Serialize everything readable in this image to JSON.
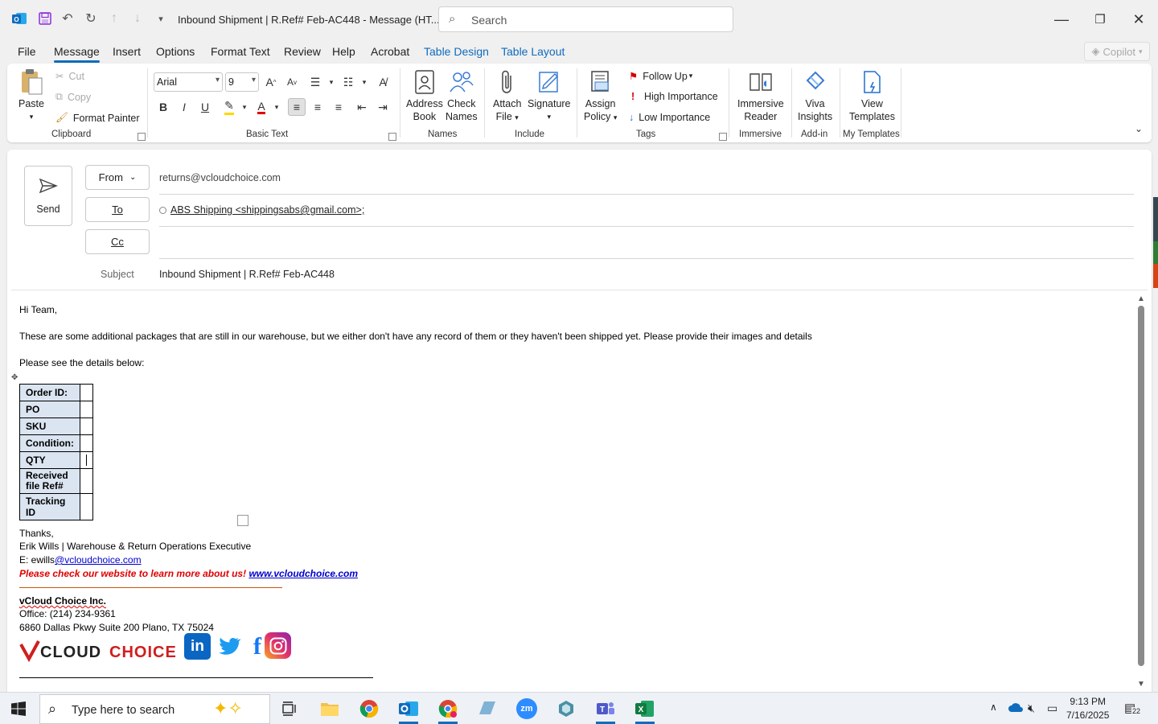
{
  "window": {
    "title": "Inbound Shipment | R.Ref# Feb-AC448 - Message (HT...",
    "search_placeholder": "Search"
  },
  "menu": {
    "tabs": [
      "File",
      "Message",
      "Insert",
      "Options",
      "Format Text",
      "Review",
      "Help",
      "Acrobat",
      "Table Design",
      "Table Layout"
    ],
    "active": "Message",
    "copilot_label": "Copilot"
  },
  "ribbon": {
    "clipboard": {
      "paste": "Paste",
      "cut": "Cut",
      "copy": "Copy",
      "format_painter": "Format Painter",
      "group": "Clipboard"
    },
    "basic_text": {
      "font": "Arial",
      "size": "9",
      "group": "Basic Text",
      "text_color": "#e00000",
      "highlight_color": "#ffd800"
    },
    "names": {
      "address_book_1": "Address",
      "address_book_2": "Book",
      "check_names_1": "Check",
      "check_names_2": "Names",
      "group": "Names"
    },
    "include": {
      "attach_1": "Attach",
      "attach_2": "File",
      "signature": "Signature",
      "group": "Include"
    },
    "tags": {
      "assign_1": "Assign",
      "assign_2": "Policy",
      "follow_up": "Follow Up",
      "high": "High Importance",
      "low": "Low Importance",
      "group": "Tags"
    },
    "immersive": {
      "reader_1": "Immersive",
      "reader_2": "Reader",
      "group": "Immersive"
    },
    "addin": {
      "viva_1": "Viva",
      "viva_2": "Insights",
      "group": "Add-in"
    },
    "templates": {
      "view_1": "View",
      "view_2": "Templates",
      "group": "My Templates"
    }
  },
  "compose": {
    "send": "Send",
    "from_label": "From",
    "from_value": "returns@vcloudchoice.com",
    "to_label": "To",
    "to_value": "ABS Shipping <shippingsabs@gmail.com>;",
    "cc_label": "Cc",
    "subject_label": "Subject",
    "subject_value": "Inbound Shipment | R.Ref# Feb-AC448"
  },
  "body": {
    "greeting": "Hi Team,",
    "para1": "These are some additional packages that are still in our warehouse, but we either don't have any record of them or they haven't been shipped yet. Please provide their images and details",
    "para2": "Please see the details below:",
    "table": [
      {
        "label": "Order ID:",
        "value": ""
      },
      {
        "label": "PO",
        "value": ""
      },
      {
        "label": "SKU",
        "value": ""
      },
      {
        "label": "Condition:",
        "value": ""
      },
      {
        "label": "QTY",
        "value": ""
      },
      {
        "label": "Received file Ref#",
        "value": ""
      },
      {
        "label": "Tracking ID",
        "value": ""
      }
    ],
    "thanks": "Thanks,",
    "sig_name": "Erik Wills | Warehouse & Return Operations Executive",
    "sig_email_prefix": "E: ewills",
    "sig_email_link": "@vcloudchoice.com",
    "sig_promo": "Please check our website to learn more about us!",
    "sig_website": "www.vcloudchoice.com",
    "company": "vCloud Choice Inc.",
    "office": "Office: (214) 234-9361",
    "address": "6860 Dallas Pkwy Suite 200 Plano, TX 75024",
    "logo_text": "VCLOUDCHOICE"
  },
  "taskbar": {
    "search_placeholder": "Type here to search",
    "time": "9:13 PM",
    "date": "7/16/2025",
    "notifications": "22"
  },
  "colors": {
    "accent": "#0f6cbd",
    "table_label_bg": "#dbe5f1",
    "promo_red": "#e00000",
    "link_blue": "#0000cc"
  }
}
